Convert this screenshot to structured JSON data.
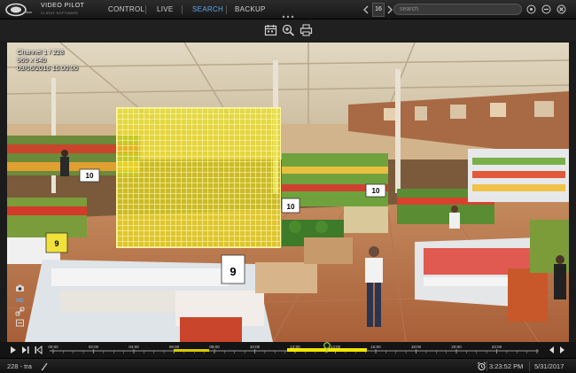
{
  "app": {
    "brand": "VIDEO PILOT",
    "brand_sub": "CLIENT SOFTWARE"
  },
  "nav": {
    "items": [
      {
        "label": "CONTROL",
        "active": false
      },
      {
        "label": "LIVE",
        "active": false
      },
      {
        "label": "SEARCH",
        "active": true
      },
      {
        "label": "BACKUP",
        "active": false
      }
    ],
    "count": "16",
    "search_placeholder": "search"
  },
  "toolbar": {
    "icons": [
      "calendar-icon",
      "zoom-in-icon",
      "print-icon"
    ]
  },
  "video": {
    "channel": "Channel 1 / 228",
    "resolution": "960 x 640",
    "timestamp": "09/06/2016 15:00:00",
    "signs": [
      "10",
      "10",
      "10",
      "9",
      "9"
    ]
  },
  "timeline": {
    "labels": [
      "00:00",
      "02:00",
      "04:00",
      "06:00",
      "08:00",
      "10:00",
      "12:00",
      "14:00",
      "16:00",
      "18:00",
      "20:00",
      "22:00"
    ]
  },
  "status": {
    "camera": "228 - tra",
    "time": "3:23:52 PM",
    "date": "5/31/2017"
  },
  "colors": {
    "accent": "#5ea8e8",
    "motion": "#ebe11e",
    "recording": "#f2e500"
  }
}
